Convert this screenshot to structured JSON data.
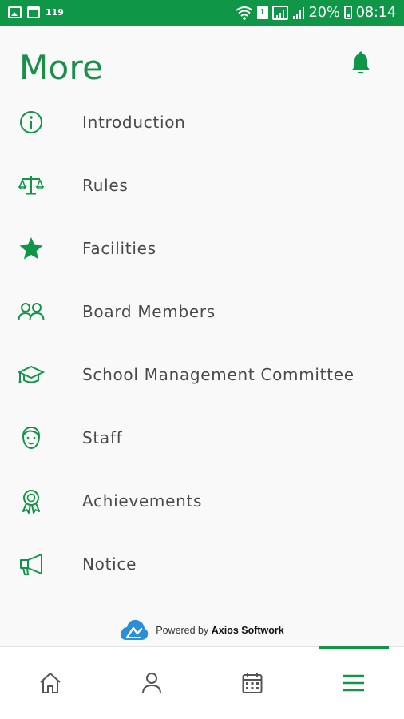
{
  "status_bar": {
    "notification_count": "119",
    "sim_badge": "1",
    "battery_percent": "20%",
    "time": "08:14",
    "icons": [
      "image-icon",
      "calendar-icon",
      "wifi-icon",
      "sim-icon",
      "signal-icon",
      "battery-icon"
    ]
  },
  "header": {
    "title": "More",
    "bell_icon": "bell-icon"
  },
  "menu": {
    "items": [
      {
        "label": "Introduction",
        "icon": "info-icon"
      },
      {
        "label": "Rules",
        "icon": "scales-icon"
      },
      {
        "label": "Facilities",
        "icon": "star-icon"
      },
      {
        "label": "Board Members",
        "icon": "users-icon"
      },
      {
        "label": "School Management Committee",
        "icon": "graduation-cap-icon"
      },
      {
        "label": "Staff",
        "icon": "face-icon"
      },
      {
        "label": "Achievements",
        "icon": "award-icon"
      },
      {
        "label": "Notice",
        "icon": "megaphone-icon"
      }
    ]
  },
  "footer": {
    "powered_prefix": "Powered by",
    "powered_brand": "Axios Softwork"
  },
  "bottom_nav": {
    "items": [
      {
        "icon": "home-icon"
      },
      {
        "icon": "profile-icon"
      },
      {
        "icon": "calendar-icon"
      },
      {
        "icon": "menu-icon",
        "active": true
      }
    ]
  },
  "colors": {
    "brand_green": "#0f9647",
    "title_green": "#1a8f4a",
    "label_text": "#4a4a4a",
    "background": "#f9f9f9"
  }
}
